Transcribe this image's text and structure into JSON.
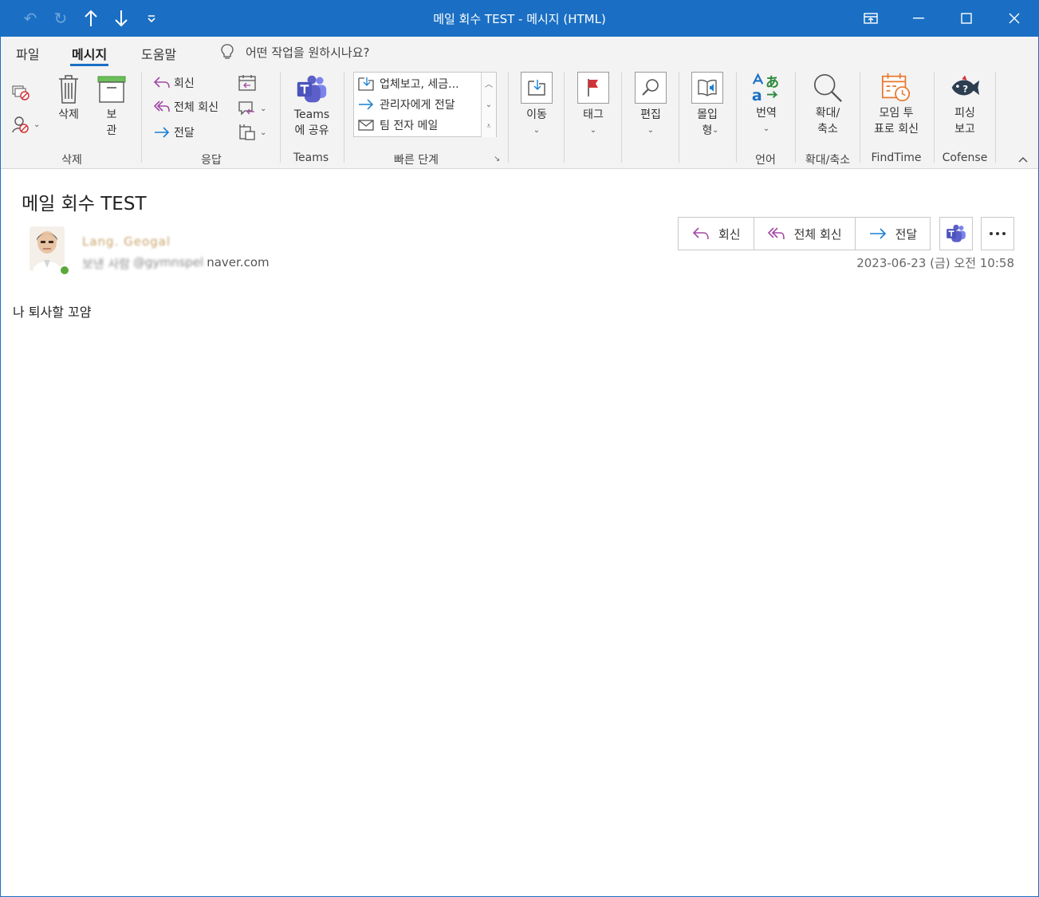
{
  "window": {
    "title": "메일 회수 TEST  -  메시지 (HTML)",
    "undo_icon": "undo-icon",
    "redo_icon": "redo-icon",
    "up_icon": "arrow-up-icon",
    "down_icon": "arrow-down-icon",
    "customize_icon": "customize-qat-icon",
    "accent": "#1a6fc4"
  },
  "tabs": {
    "file": "파일",
    "message": "메시지",
    "help": "도움말",
    "tell_me": "어떤 작업을 원하시나요?"
  },
  "ribbon": {
    "delete_group": {
      "label": "삭제",
      "delete": "삭제",
      "archive": "보\n관"
    },
    "respond_group": {
      "label": "응답",
      "reply": "회신",
      "reply_all": "전체 회신",
      "forward": "전달"
    },
    "teams_group": {
      "label": "Teams",
      "share": "Teams\n에 공유"
    },
    "quick_steps": {
      "label": "빠른 단계",
      "items": [
        "업체보고, 세금...",
        "관리자에게 전달",
        "팀 전자 메일"
      ]
    },
    "move": "이동",
    "tags": "태그",
    "editing": "편집",
    "immersive": "몰입\n형",
    "language_group": {
      "label": "언어",
      "translate": "번역"
    },
    "zoom_group": {
      "label": "확대/축소",
      "zoom": "확대/\n축소"
    },
    "findtime_group": {
      "label": "FindTime",
      "poll": "모임 투\n표로 회신"
    },
    "cofense_group": {
      "label": "Cofense",
      "report": "피싱\n보고"
    }
  },
  "message": {
    "subject": "메일 회수 TEST",
    "sender_name": "Lang. Geogal",
    "sender_prefix": "보낸 사람",
    "sender_email_hidden": "@gymnspel",
    "sender_email_domain": "naver.com",
    "date": "2023-06-23 (금) 오전 10:58",
    "body": "나 퇴사할 꼬얌",
    "actions": {
      "reply": "회신",
      "reply_all": "전체 회신",
      "forward": "전달"
    }
  }
}
